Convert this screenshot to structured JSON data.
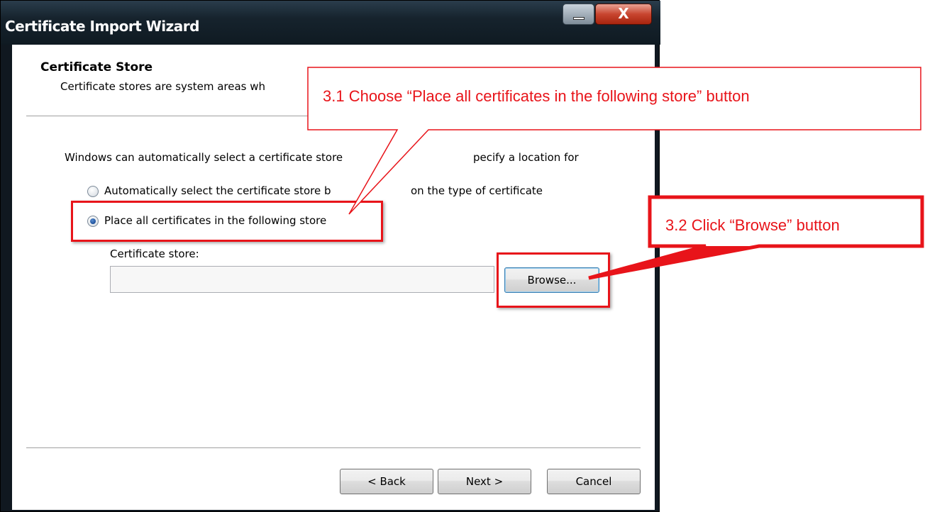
{
  "window": {
    "title": "Certificate Import Wizard",
    "close_glyph": "X"
  },
  "header": {
    "title": "Certificate Store",
    "subtitle": "Certificate stores are system areas wh"
  },
  "body": {
    "intro_left": "Windows can automatically select a certificate store",
    "intro_right": "pecify a location for",
    "radio_auto_left": "Automatically select the certificate store b",
    "radio_auto_right": "on the type of certificate",
    "radio_place": "Place all certificates in the following store",
    "store_label": "Certificate store:",
    "store_value": "",
    "browse_label": "Browse..."
  },
  "footer": {
    "back_label": "< Back",
    "next_label": "Next >",
    "cancel_label": "Cancel"
  },
  "annotations": {
    "callout_1": "3.1 Choose “Place all certificates in the following store” button",
    "callout_2": "3.2 Click “Browse” button",
    "color": "#e8141a"
  }
}
